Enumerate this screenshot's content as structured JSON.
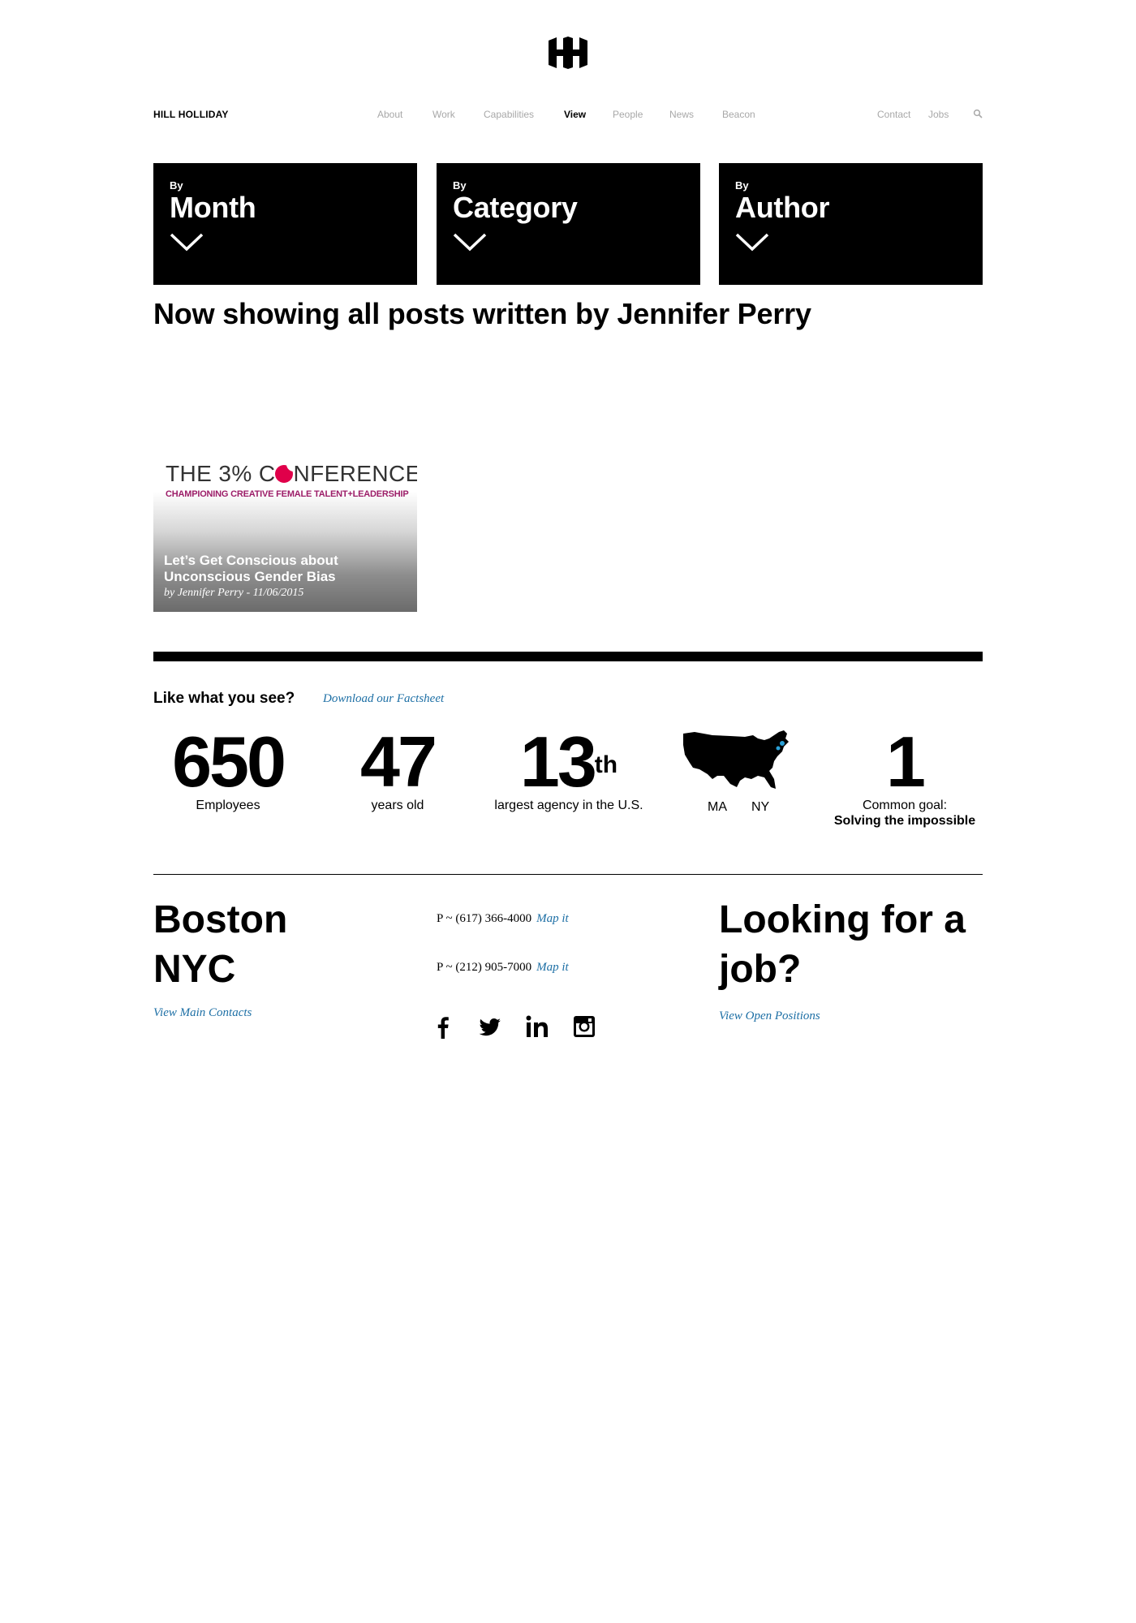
{
  "header": {
    "brand": "HILL HOLLIDAY",
    "nav": [
      "About",
      "Work",
      "Capabilities",
      "View",
      "People",
      "News",
      "Beacon"
    ],
    "active_nav": "View",
    "secondary_nav": [
      "Contact",
      "Jobs"
    ]
  },
  "filters": [
    {
      "by": "By",
      "name": "Month"
    },
    {
      "by": "By",
      "name": "Category"
    },
    {
      "by": "By",
      "name": "Author"
    }
  ],
  "heading": "Now showing all posts written by Jennifer Perry",
  "posts": [
    {
      "image_title_pre": "THE 3% C",
      "image_title_post": "NFERENCE",
      "image_subtitle": "CHAMPIONING CREATIVE FEMALE TALENT+LEADERSHIP",
      "title": "Let’s Get Conscious about Unconscious Gender Bias",
      "meta": "by Jennifer Perry - 11/06/2015"
    }
  ],
  "factsheet": {
    "prompt": "Like what you see?",
    "link": "Download our Factsheet"
  },
  "stats": {
    "employees": {
      "number": "650",
      "label": "Employees"
    },
    "age": {
      "number": "47",
      "label": "years old"
    },
    "rank": {
      "number": "13",
      "suffix": "th",
      "label": "largest agency in the U.S."
    },
    "locations": [
      "MA",
      "NY"
    ],
    "goal": {
      "number": "1",
      "label": "Common goal:",
      "label_bold": "Solving the impossible"
    }
  },
  "footer": {
    "cities": [
      "Boston",
      "NYC"
    ],
    "contacts_link": "View Main Contacts",
    "phones": [
      {
        "text": "P ~ (617) 366-4000",
        "link": "Map it"
      },
      {
        "text": "P ~ (212) 905-7000",
        "link": "Map it"
      }
    ],
    "social": [
      "facebook-icon",
      "twitter-icon",
      "linkedin-icon",
      "instagram-icon"
    ],
    "jobs_heading": "Looking for a job?",
    "jobs_link": "View Open Positions"
  },
  "colors": {
    "link": "#1d6fa5",
    "nav_inactive": "#a8a8a8",
    "accent_magenta": "#e0004a",
    "map_highlight": "#2aa0d6"
  }
}
